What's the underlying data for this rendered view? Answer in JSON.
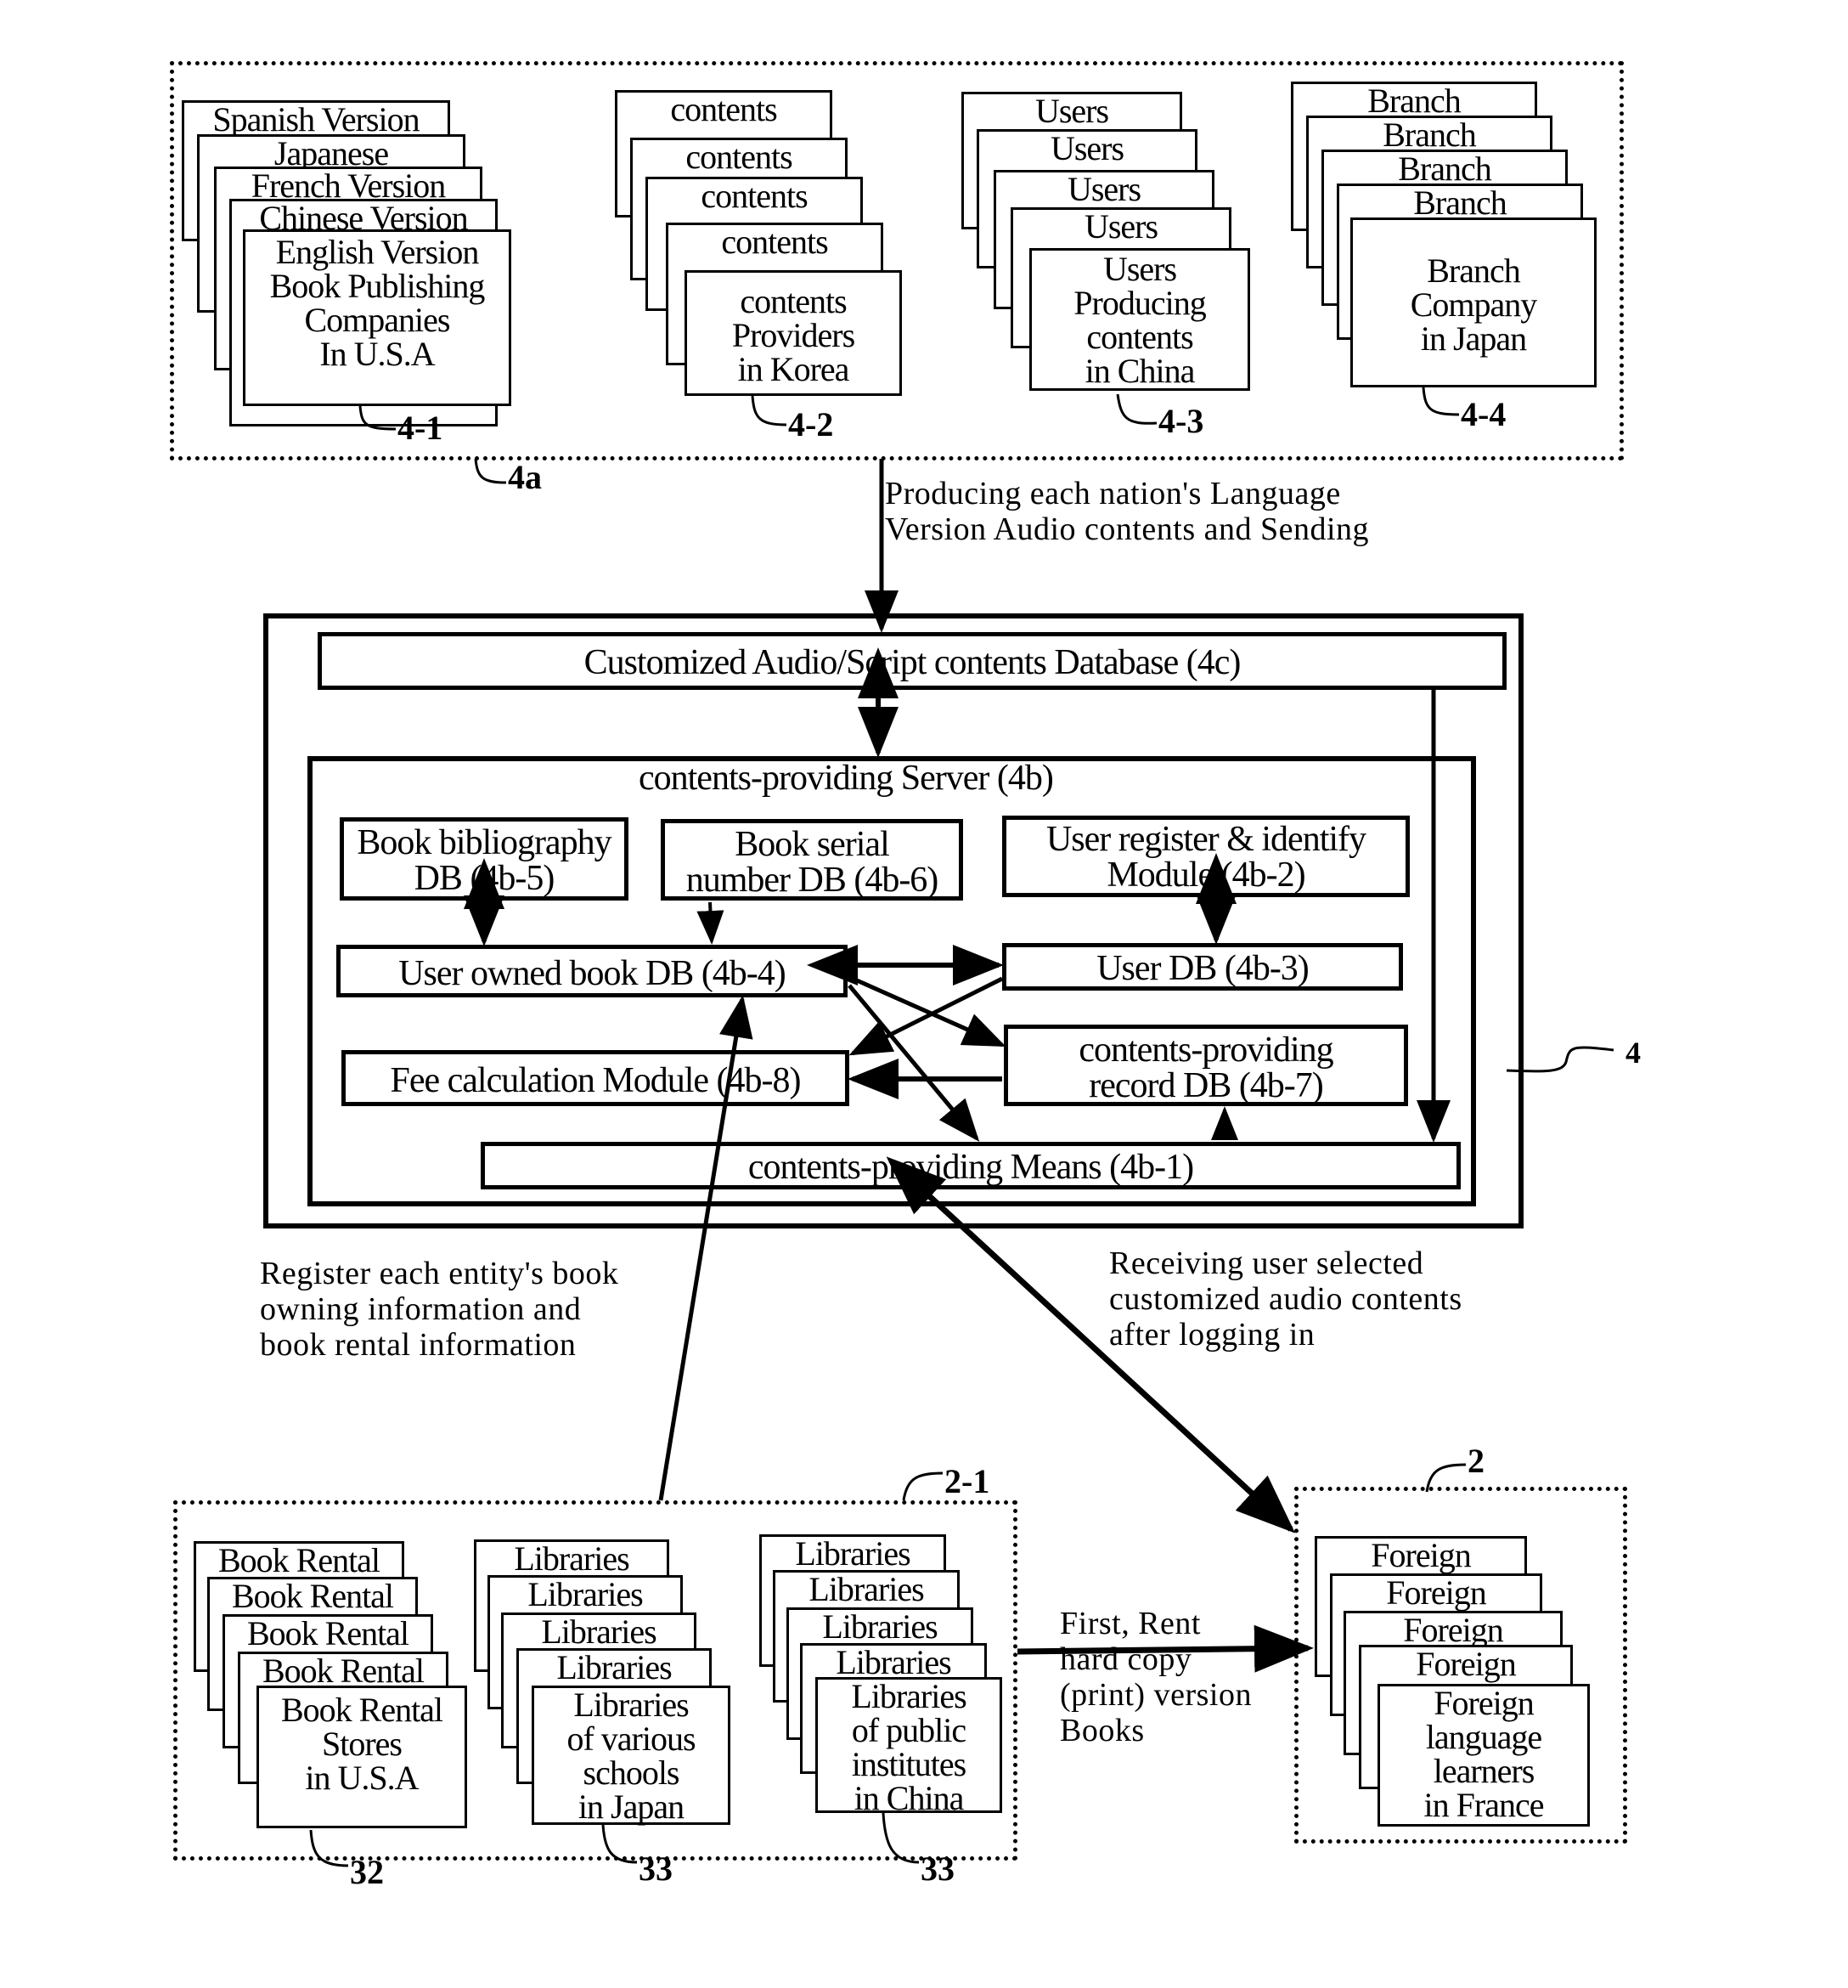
{
  "top_group": {
    "ref": "4a",
    "stacks": [
      {
        "ref": "4-1",
        "layers": [
          "Spanish Version",
          "Japanese",
          "French Version",
          "Chinese Version"
        ],
        "front": [
          "English Version",
          "Book Publishing",
          "Companies",
          "In U.S.A"
        ]
      },
      {
        "ref": "4-2",
        "layers": [
          "contents",
          "contents",
          "contents",
          "contents"
        ],
        "front": [
          "contents",
          "Providers",
          "in Korea"
        ]
      },
      {
        "ref": "4-3",
        "layers": [
          "Users",
          "Users",
          "Users",
          "Users"
        ],
        "front": [
          "Users",
          "Producing",
          "contents",
          "in China"
        ]
      },
      {
        "ref": "4-4",
        "layers": [
          "Branch",
          "Branch",
          "Branch",
          "Branch"
        ],
        "front": [
          "Branch",
          "Company",
          "in Japan"
        ]
      }
    ]
  },
  "arrow_labels": {
    "producing": [
      "Producing each nation's Language",
      "Version Audio contents and Sending"
    ],
    "register": [
      "Register each entity's book",
      "owning information and",
      "book rental information"
    ],
    "receiving": [
      "Receiving user selected",
      "customized audio contents",
      "after logging in"
    ],
    "rent": [
      "First, Rent",
      "hard copy",
      "(print) version",
      "Books"
    ]
  },
  "system": {
    "ref": "4",
    "database": "Customized Audio/Script contents Database (4c)",
    "server_title": "contents-providing Server (4b)",
    "modules": {
      "bibliography": [
        "Book bibliography",
        "DB (4b-5)"
      ],
      "serial": [
        "Book serial",
        "number DB (4b-6)"
      ],
      "user_register": [
        "User register & identify",
        "Module (4b-2)"
      ],
      "owned_book": "User owned book DB (4b-4)",
      "user_db": "User DB (4b-3)",
      "fee": "Fee calculation Module (4b-8)",
      "record": [
        "contents-providing",
        "record DB (4b-7)"
      ],
      "means": "contents-providing Means (4b-1)"
    }
  },
  "bottom_left_group": {
    "ref": "2-1",
    "stacks": [
      {
        "ref": "32",
        "layers": [
          "Book Rental",
          "Book Rental",
          "Book Rental",
          "Book Rental"
        ],
        "front": [
          "Book Rental",
          "Stores",
          "in U.S.A"
        ]
      },
      {
        "ref": "33",
        "layers": [
          "Libraries",
          "Libraries",
          "Libraries",
          "Libraries"
        ],
        "front": [
          "Libraries",
          "of various",
          "schools",
          "in Japan"
        ]
      },
      {
        "ref": "33",
        "layers": [
          "Libraries",
          "Libraries",
          "Libraries",
          "Libraries"
        ],
        "front": [
          "Libraries",
          "of public",
          "institutes",
          "in China"
        ]
      }
    ]
  },
  "bottom_right_group": {
    "ref": "2",
    "layers": [
      "Foreign",
      "Foreign",
      "Foreign",
      "Foreign"
    ],
    "front": [
      "Foreign",
      "language",
      "learners",
      "in France"
    ]
  }
}
